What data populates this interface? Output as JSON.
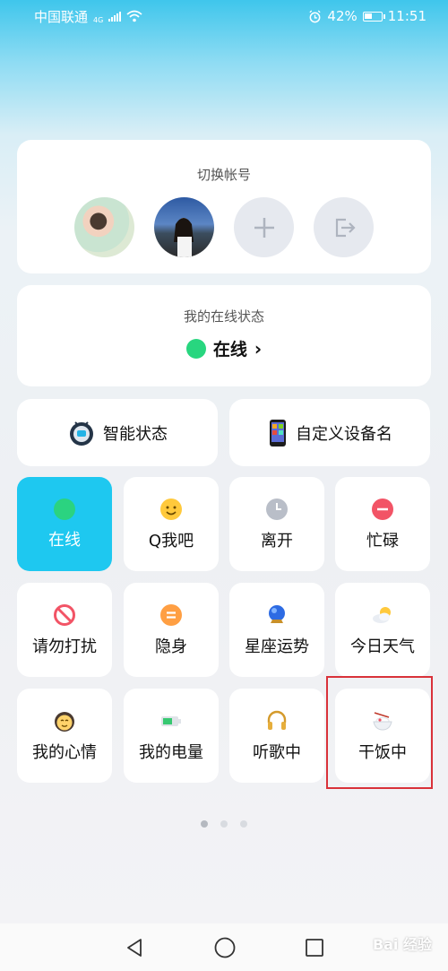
{
  "status_bar": {
    "carrier": "中国联通",
    "network": "4G",
    "battery": "42%",
    "time": "11:51"
  },
  "switch_account": {
    "title": "切换帐号",
    "avatars": [
      "user-avatar-1",
      "user-avatar-2"
    ],
    "add_icon": "plus-icon",
    "logout_icon": "logout-icon"
  },
  "online_status": {
    "title": "我的在线状态",
    "value": "在线",
    "color": "#28d67f"
  },
  "shortcuts": {
    "smart_status": "智能状态",
    "custom_device": "自定义设备名"
  },
  "tiles": [
    {
      "label": "在线",
      "icon": "green-dot-icon",
      "active": true
    },
    {
      "label": "Q我吧",
      "icon": "smile-icon"
    },
    {
      "label": "离开",
      "icon": "clock-icon"
    },
    {
      "label": "忙碌",
      "icon": "busy-icon"
    },
    {
      "label": "请勿打扰",
      "icon": "no-disturb-icon"
    },
    {
      "label": "隐身",
      "icon": "invisible-icon"
    },
    {
      "label": "星座运势",
      "icon": "crystal-ball-icon"
    },
    {
      "label": "今日天气",
      "icon": "weather-icon"
    },
    {
      "label": "我的心情",
      "icon": "mood-icon"
    },
    {
      "label": "我的电量",
      "icon": "battery-icon"
    },
    {
      "label": "听歌中",
      "icon": "headphones-icon"
    },
    {
      "label": "干饭中",
      "icon": "rice-bowl-icon"
    }
  ],
  "colors": {
    "accent": "#1ec8f0",
    "highlight": "#d9323a"
  },
  "pager": {
    "pages": 3,
    "current": 1
  },
  "watermark": "Bai 经验"
}
